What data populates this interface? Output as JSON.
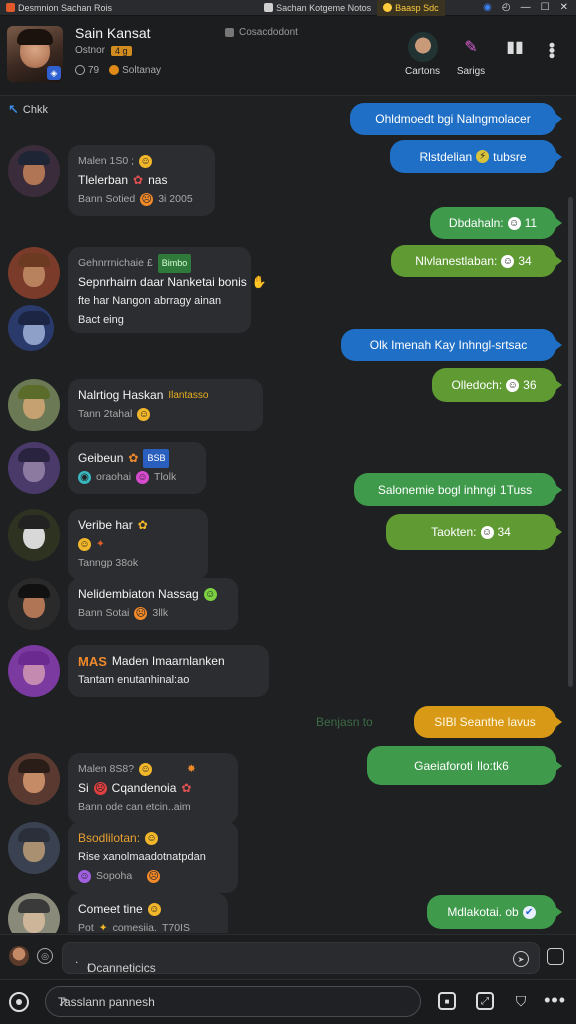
{
  "tabs": [
    {
      "label": "Desmnion Sachan  Rois",
      "color": "#e05a2b",
      "state": "normal"
    },
    {
      "label": "Sachan  Kotgeme  Notos",
      "color": "#cfcfcf",
      "state": "active"
    },
    {
      "label": "Baasp Sdc",
      "color": "#ffcd3c",
      "state": "warn"
    }
  ],
  "header": {
    "name": "Sain Kansat",
    "subtitle": "Ostnor",
    "tag": "4 g",
    "status": "Cosacdodont",
    "meta_count": "79",
    "meta_label": "Soltanay",
    "actions": [
      {
        "label": "Cartons",
        "icon": "avatar-icon"
      },
      {
        "label": "Sarigs",
        "icon": "feather-icon"
      },
      {
        "label": "",
        "icon": "bars-icon"
      }
    ]
  },
  "chat": {
    "back_label": "Chkk",
    "outgoing": [
      {
        "text": "Ohldmoedt bgi Nalngmolacer",
        "color": "blue",
        "emoji": ""
      },
      {
        "text": "Rlstdelian",
        "color": "blue",
        "emoji": "⚡",
        "suffix": "tubsre"
      },
      {
        "text": "Dbdahaln:",
        "color": "green",
        "emoji": "☺",
        "suffix": "11"
      },
      {
        "text": "Nlvlanestlaban:",
        "color": "lime",
        "emoji": "☺",
        "suffix": "34"
      },
      {
        "text": "Olk Imenah Kay Inhngl-srtsac",
        "color": "blue",
        "emoji": ""
      },
      {
        "text": "Olledoch:",
        "color": "lime",
        "emoji": "☺",
        "suffix": "36"
      },
      {
        "text": "Salonemie bogl inhngi",
        "color": "green",
        "emoji": "",
        "suffix": "1Tuss"
      },
      {
        "text": "Taokten:",
        "color": "lime",
        "emoji": "☺",
        "suffix": "34"
      },
      {
        "text": "SIBl Seanthe lavus",
        "color": "orange",
        "emoji": ""
      },
      {
        "text": "Gaeiaforoti",
        "color": "green",
        "emoji": "",
        "suffix": "Ilo:tk6"
      },
      {
        "text": "Mdlakotai. ob",
        "color": "green",
        "emoji": "✔",
        "suffix": ""
      }
    ],
    "incoming": [
      {
        "line1": "Malen 1S0 ;",
        "line2": "Tlelerban",
        "line2b": "nas",
        "line3": "Bann Sotied",
        "line3b": "3i 2005",
        "avatar": {
          "face": "#b07555",
          "hat": "#1e2535",
          "bg": "#3a2c3a"
        }
      },
      {
        "line1": "Gehnrrnichaie £",
        "line1b": "Bimbo",
        "line2": "Sepnrhairn daar Nanketai bonis",
        "line3": "fte har  Nangon abrragy ainan",
        "line4": "Bact eing",
        "avatar": {
          "face": "#b8825f",
          "hat": "#6b3a20",
          "bg": "#7a3b2a"
        }
      },
      {
        "line1": "Nalrtiog Haskan",
        "line1b": "Ilantasso",
        "line2": "Tann 2tahal",
        "avatar": {
          "face": "#c5a070",
          "hat": "#5b6b2a",
          "bg": "#6b7a55"
        }
      },
      {
        "line1": "Geibeun",
        "line1b": "BSB",
        "line2": "oraohai",
        "line2b": "Tlolk",
        "avatar": {
          "face": "#8c7aa0",
          "hat": "#2a2340",
          "bg": "#4a3a6a"
        }
      },
      {
        "line1": "Veribe har",
        "line2": "Tanngp 38ok",
        "avatar": {
          "face": "#d8d8d8",
          "hat": "#222",
          "bg": "#2d3320"
        }
      },
      {
        "line1": "Nelidembiaton Nassag",
        "line2": "Bann Sotai",
        "line2b": "3llk",
        "avatar": {
          "face": "#b07555",
          "hat": "#111",
          "bg": "#2a2a2a"
        }
      },
      {
        "line1": "MAS",
        "line1b": "Maden Imaarnlanken",
        "line2": "Tantam enutanhinal:ao",
        "avatar": {
          "face": "#c58ab0",
          "hat": "#6a2a90",
          "bg": "#7a3aa0"
        }
      },
      {
        "line1": "Malen 8S8?",
        "line2": "Si",
        "line2b": "Cqandenoia",
        "line3": "Bann ode can etcin..aim",
        "avatar": {
          "face": "#c58b66",
          "hat": "#2a1d18",
          "bg": "#5a3a30"
        }
      },
      {
        "line1": "Bsodlilotan:",
        "line2": "Rise xanolmaadotnatpdan",
        "line3": "Sopoha",
        "avatar": {
          "face": "#a89070",
          "hat": "#2b2f3a",
          "bg": "#3a4150"
        }
      },
      {
        "line1": "Comeet tine",
        "line2": "Pot",
        "line2b": "comesiia.",
        "line2c": "T70IS",
        "avatar": {
          "face": "#cdb59a",
          "hat": "#3a3a3a",
          "bg": "#8a8a7a"
        }
      }
    ],
    "center_note": "Benjasn to"
  },
  "composer": {
    "placeholder": "Ocanneticics",
    "cursor": "I"
  },
  "bottombar": {
    "search_placeholder": "Tasslann pannesh"
  },
  "colors": {
    "blue": "#1f6fc6",
    "green": "#3f9a4c",
    "lime": "#5f9a33",
    "orange": "#d89a16"
  }
}
